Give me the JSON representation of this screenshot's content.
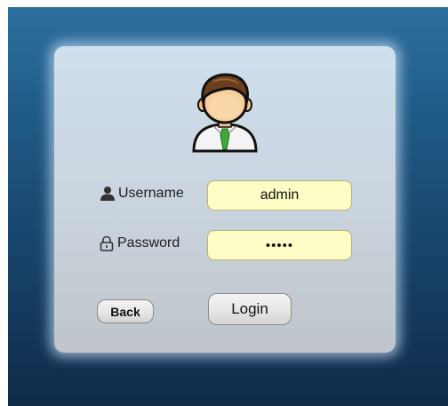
{
  "login_form": {
    "username_label": "Username",
    "password_label": "Password",
    "username_value": "admin",
    "password_value": "•••••",
    "back_label": "Back",
    "login_label": "Login"
  },
  "icons": {
    "avatar": "user-avatar-icon",
    "username": "user-icon",
    "password": "lock-icon"
  },
  "colors": {
    "background_top": "#2d6f9f",
    "background_bottom": "#0f2b48",
    "field_fill": "#fdfdc5",
    "panel": "#c9d3dc"
  }
}
